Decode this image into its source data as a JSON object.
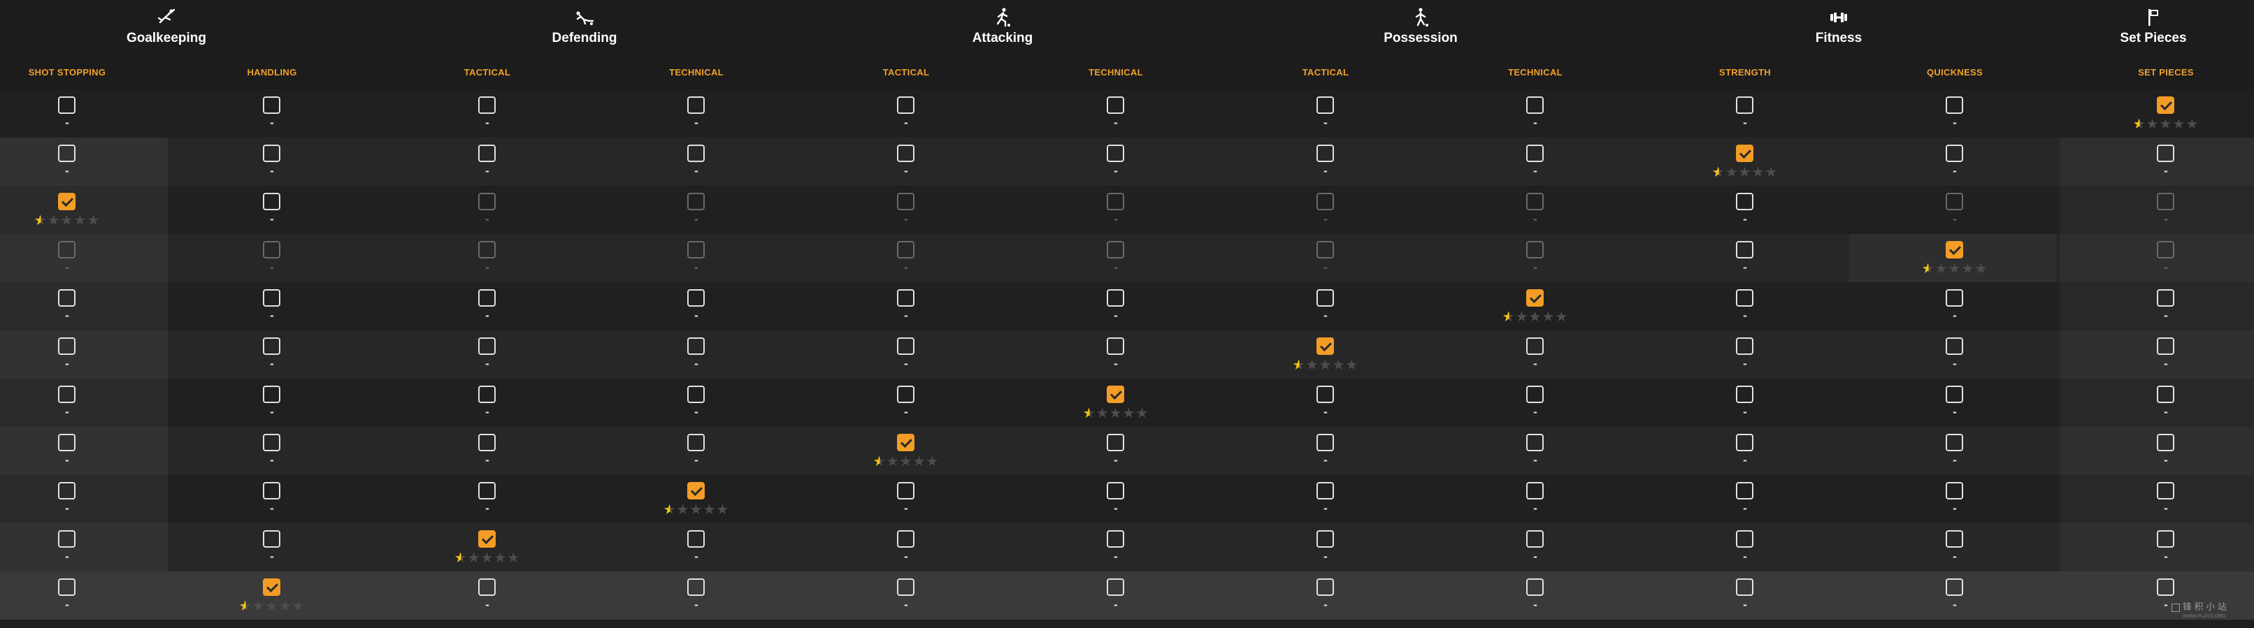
{
  "categories": [
    {
      "title": "Goalkeeping",
      "icon": "goalkeeper-dive-icon"
    },
    {
      "title": "Defending",
      "icon": "defender-slide-tackle-icon"
    },
    {
      "title": "Attacking",
      "icon": "attacker-running-icon"
    },
    {
      "title": "Possession",
      "icon": "player-dribbling-icon"
    },
    {
      "title": "Fitness",
      "icon": "dumbbell-icon"
    },
    {
      "title": "Set Pieces",
      "icon": "corner-flag-icon"
    }
  ],
  "columns": [
    "SHOT STOPPING",
    "HANDLING",
    "TACTICAL",
    "TECHNICAL",
    "TACTICAL",
    "TECHNICAL",
    "TACTICAL",
    "TECHNICAL",
    "STRENGTH",
    "QUICKNESS",
    "SET PIECES"
  ],
  "empty_rating": "-",
  "rating": {
    "max_stars": 5,
    "value": 0.5
  },
  "rows": [
    {
      "checked": [
        10
      ],
      "dimmed": []
    },
    {
      "checked": [
        8
      ],
      "dimmed": []
    },
    {
      "checked": [
        0
      ],
      "dimmed": [
        2,
        3,
        4,
        5,
        6,
        7,
        9,
        10
      ]
    },
    {
      "checked": [
        9
      ],
      "dimmed": [
        0,
        1,
        2,
        3,
        4,
        5,
        6,
        7,
        10
      ]
    },
    {
      "checked": [
        7
      ],
      "dimmed": []
    },
    {
      "checked": [
        6
      ],
      "dimmed": []
    },
    {
      "checked": [
        5
      ],
      "dimmed": []
    },
    {
      "checked": [
        4
      ],
      "dimmed": []
    },
    {
      "checked": [
        3
      ],
      "dimmed": []
    },
    {
      "checked": [
        2
      ],
      "dimmed": []
    },
    {
      "checked": [
        1
      ],
      "dimmed": []
    }
  ],
  "colors": {
    "accent": "#f39c26",
    "star": "#f5c518",
    "header_text": "#f0a02a"
  },
  "watermark": {
    "text": "锋 积 小 站",
    "subtext": "WWW.PLAYS.ORG"
  }
}
